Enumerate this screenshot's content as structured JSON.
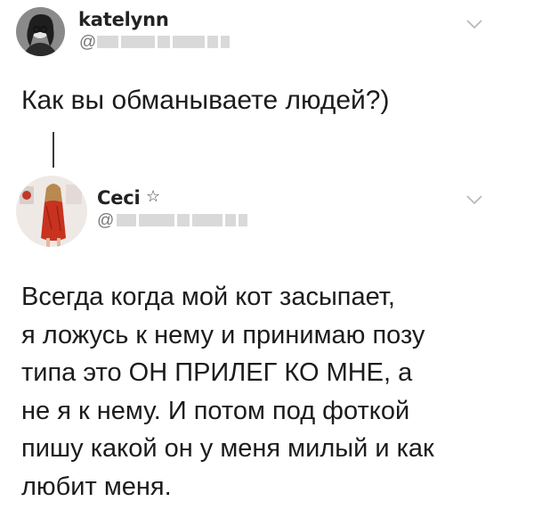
{
  "tweet1": {
    "name": "katelynn",
    "handle_prefix": "@",
    "text": "Как вы обманываете людей?)"
  },
  "tweet2": {
    "name": "Ceci",
    "badge": "☆",
    "handle_prefix": "@",
    "lines": [
      "Всегда когда мой кот засыпает,",
      "я ложусь к нему и принимаю позу",
      "типа это ОН ПРИЛЕГ КО МНЕ, а",
      "не я к нему. И потом под фоткой",
      "пишу какой он у меня милый и как",
      "любит меня."
    ]
  },
  "icons": {
    "menu": "chevron-down-icon",
    "thread": "thread-connector"
  },
  "colors": {
    "text": "#1c1c1c",
    "handle": "#777777",
    "redaction": "#d9d9d9",
    "dress": "#c8321f"
  }
}
